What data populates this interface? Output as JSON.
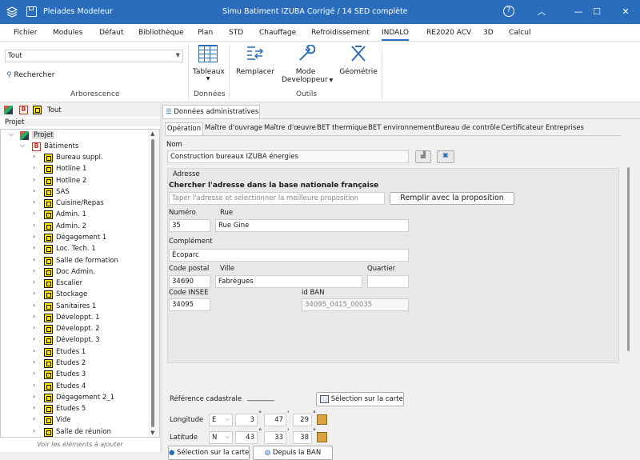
{
  "titlebar": {
    "app": "Pleiades Modeleur",
    "doc": "Simu Batiment IZUBA Corrigé / 14 SED complète"
  },
  "menu": [
    "Fichier",
    "Modules",
    "Défaut",
    "Bibliothèque",
    "Plan",
    "STD",
    "Chauffage",
    "Refroidissement",
    "INDALO",
    "RE2020 ACV",
    "3D",
    "Calcul"
  ],
  "ribbon": {
    "filter_value": "Tout",
    "search_label": "Rechercher",
    "group_arbo": "Arborescence",
    "tableaux": "Tableaux",
    "group_donnees": "Données",
    "remplacer": "Remplacer",
    "mode_dev": "Mode",
    "mode_dev2": "Developpeur",
    "geometrie": "Géométrie",
    "group_outils": "Outils"
  },
  "tree": {
    "header_label": "Tout",
    "section": "Projet",
    "project": "Projet",
    "buildings": "Bâtiments",
    "items": [
      "Bureau suppl.",
      "Hotline 1",
      "Hotline 2",
      "SAS",
      "Cuisine/Repas",
      "Admin. 1",
      "Admin. 2",
      "Dégagement 1",
      "Loc. Tech. 1",
      "Salle de formation",
      "Doc Admin.",
      "Escalier",
      "Stockage",
      "Sanitaires 1",
      "Développt. 1",
      "Développt. 2",
      "Développt. 3",
      "Etudes 1",
      "Etudes 2",
      "Etudes 3",
      "Etudes 4",
      "Dégagement 2_1",
      "Etudes 5",
      "Vide",
      "Salle de réunion"
    ],
    "footer": "Voir les éléments à ajouter"
  },
  "main": {
    "doc_tab": "Données administratives",
    "tabs": [
      "Opération",
      "Maître d'ouvrage",
      "Maître d'œuvre",
      "BET thermique",
      "BET environnement",
      "Bureau de contrôle",
      "Certificateur",
      "Entreprises"
    ],
    "nom_label": "Nom",
    "nom_value": "Construction bureaux IZUBA énergies",
    "adresse_legend": "Adresse",
    "search_title": "Chercher l'adresse dans la base nationale française",
    "search_placeholder": "Taper l'adresse et sélectionner la meilleure proposition",
    "fill_button": "Remplir avec la proposition",
    "numero_label": "Numéro",
    "numero_value": "35",
    "rue_label": "Rue",
    "rue_value": "Rue Gine",
    "complement_label": "Complément",
    "complement_value": "Écoparc",
    "cp_label": "Code postal",
    "cp_value": "34690",
    "ville_label": "Ville",
    "ville_value": "Fabrègues",
    "quartier_label": "Quartier",
    "quartier_value": "",
    "insee_label": "Code INSEE",
    "insee_value": "34095",
    "idban_label": "id BAN",
    "idban_value": "34095_0415_00035",
    "cadastre_label": "Référence cadastrale",
    "cadastre_value": "________",
    "map_button": "Sélection sur la carte",
    "longitude_label": "Longitude",
    "long_dir": "E",
    "long_deg": "3",
    "long_min": "47",
    "long_sec": "29",
    "latitude_label": "Latitude",
    "lat_dir": "N",
    "lat_deg": "43",
    "lat_min": "33",
    "lat_sec": "38",
    "deg_sym": "°",
    "min_sym": "'",
    "sec_sym": "\"",
    "map_button2": "Sélection sur la carte",
    "ban_button": "Depuis la BAN"
  },
  "colors": {
    "titlebar": "#2b6dbd",
    "accent": "#2b6dbd"
  }
}
